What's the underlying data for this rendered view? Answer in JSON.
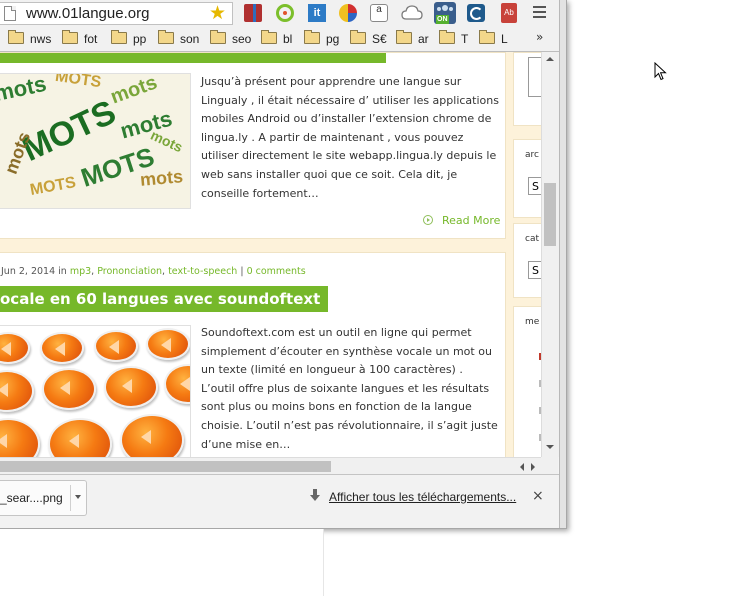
{
  "browser": {
    "url": "www.01langue.org",
    "extensions": [
      "bookmark-ext",
      "circle-ext",
      "it",
      "pie-ext",
      "a",
      "cloud-ext",
      "ON",
      "power-ext",
      "Ab"
    ],
    "bookmarks": [
      "nws",
      "fot",
      "pp",
      "son",
      "seo",
      "bl",
      "pg",
      "S€",
      "ar",
      "T",
      "L"
    ],
    "bookmarks_more": "»"
  },
  "post1": {
    "excerpt": "Jusqu’à présent pour apprendre une langue  sur Lingualy , il était nécessaire d’ utiliser les applications mobiles Android ou d’installer l’extension chrome de lingua.ly . A partir de maintenant , vous pouvez utiliser directement le site webapp.lingua.ly  depuis le web sans installer quoi que ce soit. Cela dit, je conseille fortement…",
    "read_more": "Read More",
    "thumb_words": [
      "mots",
      "MOTS",
      "mots",
      "MOTS",
      "mots",
      "mots",
      "MOTS",
      "mots",
      "MOTS",
      "mots"
    ]
  },
  "post2": {
    "date": "Jun 2, 2014",
    "in": " in ",
    "cat1": "mp3",
    "sep1": ", ",
    "cat2": "Prononciation",
    "sep2": ", ",
    "cat3": "text-to-speech",
    "sep3": " | ",
    "comments": "0 comments",
    "title": "ocale en 60 langues avec soundoftext",
    "excerpt": "Soundoftext.com est un outil en ligne qui permet simplement d’écouter  en synthèse vocale un mot ou un texte (limité en longueur à 100 caractères) . L’outil offre plus de soixante langues et les résultats sont plus ou moins bons en fonction de la langue choisie.  L’outil n’est pas révolutionnaire, il s’agit juste d’une mise en…"
  },
  "sidebar": {
    "widget1_label": "arc",
    "widget1_select": "S",
    "widget2_label": "cat",
    "widget2_select": "S",
    "widget3_label": "me"
  },
  "downloads": {
    "file": "_sear....png",
    "show_all": "Afficher tous les téléchargements...",
    "close": "×"
  },
  "colors": {
    "accent": "#76b82a",
    "page_bg": "#fdf2da",
    "bubble": "#f57a12"
  }
}
